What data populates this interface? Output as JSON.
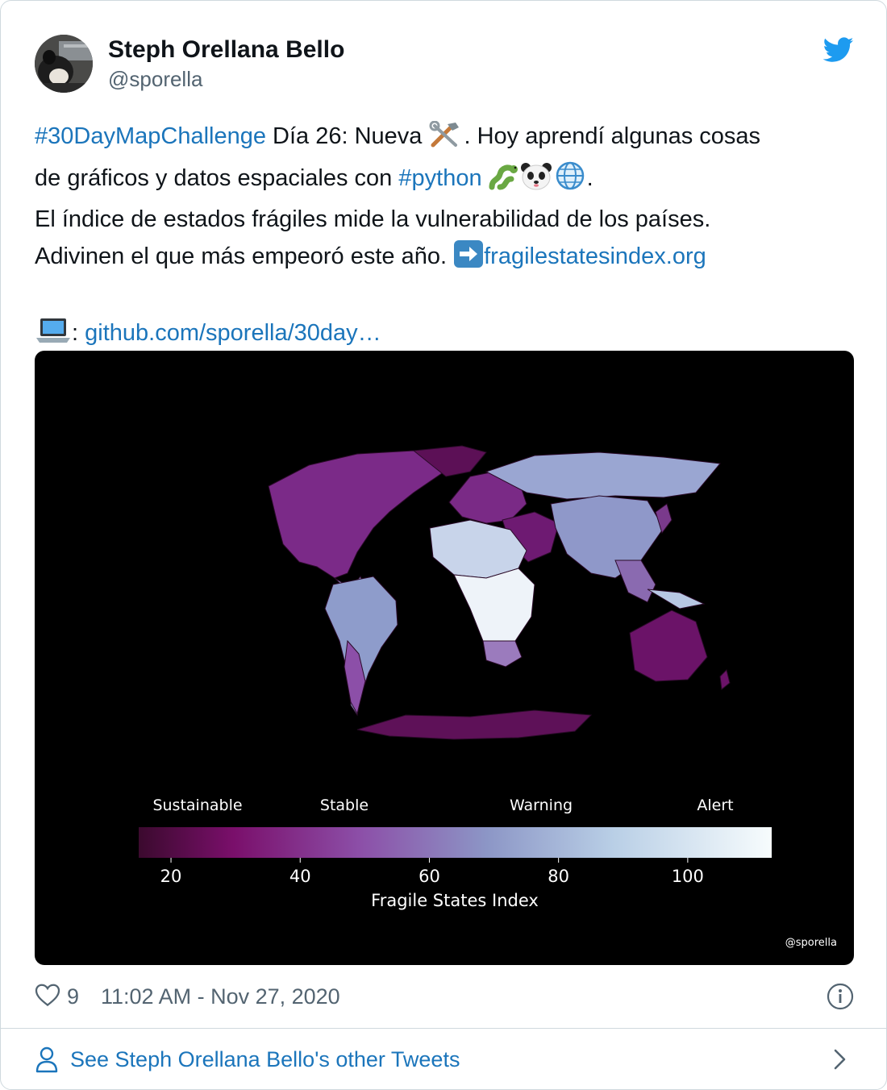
{
  "author": {
    "name": "Steph Orellana Bello",
    "handle": "@sporella"
  },
  "tweet": {
    "hashtag1": "#30DayMapChallenge",
    "t1": " Día 26: Nueva ",
    "t2": ". Hoy aprendí algunas cosas",
    "t3": "de gráficos y datos espaciales con ",
    "hashtag2": "#python",
    "t4": ".",
    "line3": "El índice de estados frágiles mide la vulnerabilidad de los países.",
    "t5": "Adivinen el que más empeoró este año. ",
    "link1": "fragilestatesindex.org",
    "t6": ": ",
    "link2": "github.com/sporella/30day…"
  },
  "media": {
    "colors": {
      "low": "#3b0a2e",
      "mid": "#8c6bb1",
      "high": "#f7fcfd"
    },
    "chart_data": {
      "type": "choropleth",
      "colorbar": {
        "label": "Fragile States Index",
        "ticks": [
          20,
          40,
          60,
          80,
          100
        ],
        "range": [
          15,
          113
        ],
        "categories": [
          "Sustainable",
          "Stable",
          "Warning",
          "Alert"
        ]
      },
      "credit": "@sporella"
    }
  },
  "footer": {
    "likes": "9",
    "timestamp": "11:02 AM - Nov 27, 2020"
  },
  "more": {
    "label": "See Steph Orellana Bello's other Tweets"
  },
  "icons": {
    "brand": "twitter-bird-icon",
    "like": "heart-icon",
    "info": "info-icon",
    "profile": "person-icon",
    "chevron": "chevron-right-icon"
  }
}
